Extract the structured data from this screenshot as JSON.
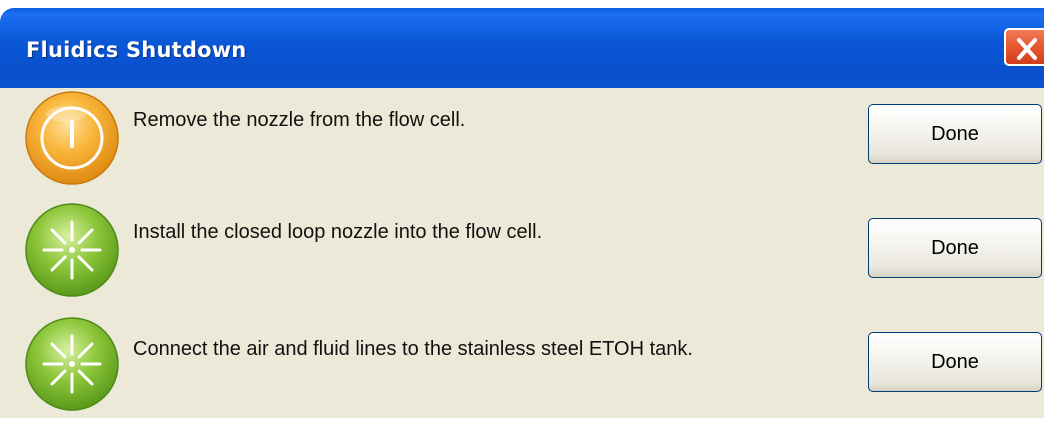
{
  "window": {
    "title": "Fluidics Shutdown",
    "close_icon": "close-icon"
  },
  "steps": [
    {
      "status_icon": "warning-icon",
      "status": "pending",
      "text": "Remove the nozzle from the flow cell.",
      "button_label": "Done"
    },
    {
      "status_icon": "sparkle-icon",
      "status": "ready",
      "text": "Install the closed loop nozzle into the flow cell.",
      "button_label": "Done"
    },
    {
      "status_icon": "sparkle-icon",
      "status": "ready",
      "text": "Connect the air and fluid lines to the stainless steel ETOH tank.",
      "button_label": "Done"
    }
  ],
  "colors": {
    "titlebar": "#0b58d8",
    "window_bg": "#ece9d8",
    "close_button": "#e2512a",
    "warning_orange": "#f5a021",
    "ready_green": "#7fbf2a"
  }
}
